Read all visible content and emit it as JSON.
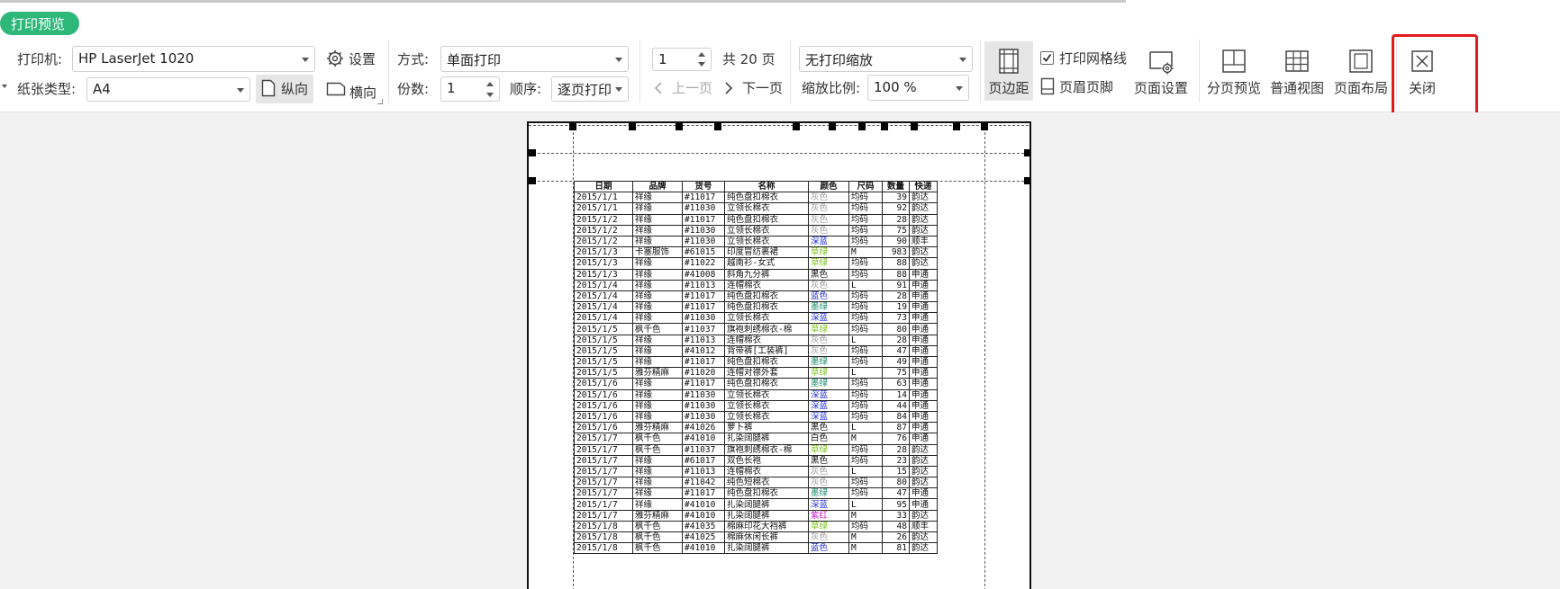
{
  "window": {
    "tab_label": "打印预览"
  },
  "printer": {
    "label": "打印机:",
    "value": "HP LaserJet 1020",
    "settings_label": "设置"
  },
  "paper": {
    "label": "纸张类型:",
    "value": "A4",
    "portrait_label": "纵向",
    "landscape_label": "横向"
  },
  "mode": {
    "label": "方式:",
    "value": "单面打印"
  },
  "copies": {
    "label": "份数:",
    "value": "1"
  },
  "order": {
    "label": "顺序:",
    "value": "逐页打印"
  },
  "pager": {
    "page_value": "1",
    "total_label": "共 20 页",
    "prev_label": "上一页",
    "next_label": "下一页"
  },
  "scale": {
    "mode_value": "无打印缩放",
    "ratio_label": "缩放比例:",
    "ratio_value": "100 %"
  },
  "toolbar": {
    "margins_label": "页边距",
    "gridlines_label": "打印网格线",
    "gridlines_checked": true,
    "header_footer_label": "页眉页脚",
    "page_setup_label": "页面设置",
    "page_break_label": "分页预览",
    "normal_view_label": "普通视图",
    "page_layout_label": "页面布局",
    "close_label": "关闭"
  },
  "colors": {
    "accent_green": "#2db87a",
    "highlight_red": "#e0191e",
    "active_bg": "#e6e6e6"
  },
  "sheet": {
    "headers": [
      "日期",
      "品牌",
      "货号",
      "名称",
      "颜色",
      "尺码",
      "数量",
      "快递"
    ],
    "rows": [
      [
        "2015/1/1",
        "祥缘",
        "#11017",
        "纯色盘扣棉衣",
        "灰色",
        "均码",
        "39",
        "韵达"
      ],
      [
        "2015/1/1",
        "祥缘",
        "#11030",
        "立领长棉衣",
        "灰色",
        "均码",
        "92",
        "韵达"
      ],
      [
        "2015/1/2",
        "祥缘",
        "#11017",
        "纯色盘扣棉衣",
        "灰色",
        "均码",
        "28",
        "韵达"
      ],
      [
        "2015/1/2",
        "祥缘",
        "#11030",
        "立领长棉衣",
        "灰色",
        "均码",
        "75",
        "韵达"
      ],
      [
        "2015/1/2",
        "祥缘",
        "#11030",
        "立领长棉衣",
        "深蓝",
        "均码",
        "90",
        "顺丰"
      ],
      [
        "2015/1/3",
        "卡塞服饰",
        "#61015",
        "印度冒纺裹裙",
        "草绿",
        "M",
        "983",
        "韵达"
      ],
      [
        "2015/1/3",
        "祥缘",
        "#11022",
        "越南衫-女式",
        "草绿",
        "均码",
        "88",
        "韵达"
      ],
      [
        "2015/1/3",
        "祥缘",
        "#41008",
        "斜角九分裤",
        "黑色",
        "均码",
        "88",
        "申通"
      ],
      [
        "2015/1/4",
        "祥缘",
        "#11013",
        "连帽棉衣",
        "灰色",
        "L",
        "91",
        "申通"
      ],
      [
        "2015/1/4",
        "祥缘",
        "#11017",
        "纯色盘扣棉衣",
        "蓝色",
        "均码",
        "28",
        "申通"
      ],
      [
        "2015/1/4",
        "祥缘",
        "#11017",
        "纯色盘扣棉衣",
        "墨绿",
        "均码",
        "19",
        "申通"
      ],
      [
        "2015/1/4",
        "祥缘",
        "#11030",
        "立领长棉衣",
        "深蓝",
        "均码",
        "73",
        "申通"
      ],
      [
        "2015/1/5",
        "枫千色",
        "#11037",
        "旗袍刺绣棉衣-棉",
        "草绿",
        "均码",
        "80",
        "申通"
      ],
      [
        "2015/1/5",
        "祥缘",
        "#11013",
        "连帽棉衣",
        "灰色",
        "L",
        "28",
        "申通"
      ],
      [
        "2015/1/5",
        "祥缘",
        "#41012",
        "背带裤[工装裤]",
        "灰色",
        "均码",
        "47",
        "申通"
      ],
      [
        "2015/1/5",
        "祥缘",
        "#11017",
        "纯色盘扣棉衣",
        "墨绿",
        "均码",
        "49",
        "申通"
      ],
      [
        "2015/1/5",
        "雅芬精麻",
        "#11020",
        "连帽对襟外套",
        "草绿",
        "L",
        "75",
        "申通"
      ],
      [
        "2015/1/6",
        "祥缘",
        "#11017",
        "纯色盘扣棉衣",
        "墨绿",
        "均码",
        "63",
        "申通"
      ],
      [
        "2015/1/6",
        "祥缘",
        "#11030",
        "立领长棉衣",
        "深蓝",
        "均码",
        "14",
        "申通"
      ],
      [
        "2015/1/6",
        "祥缘",
        "#11030",
        "立领长棉衣",
        "深蓝",
        "均码",
        "44",
        "申通"
      ],
      [
        "2015/1/6",
        "祥缘",
        "#11030",
        "立领长棉衣",
        "深蓝",
        "均码",
        "84",
        "申通"
      ],
      [
        "2015/1/6",
        "雅芬精麻",
        "#41026",
        "萝卜裤",
        "黑色",
        "L",
        "87",
        "申通"
      ],
      [
        "2015/1/7",
        "枫千色",
        "#41010",
        "扎染阔腿裤",
        "白色",
        "M",
        "76",
        "申通"
      ],
      [
        "2015/1/7",
        "枫千色",
        "#11037",
        "旗袍刺绣棉衣-棉",
        "草绿",
        "均码",
        "28",
        "韵达"
      ],
      [
        "2015/1/7",
        "祥缘",
        "#61017",
        "双色长袍",
        "黑色",
        "均码",
        "23",
        "韵达"
      ],
      [
        "2015/1/7",
        "祥缘",
        "#11013",
        "连帽棉衣",
        "灰色",
        "L",
        "15",
        "韵达"
      ],
      [
        "2015/1/7",
        "祥缘",
        "#11042",
        "纯色短棉衣",
        "灰色",
        "均码",
        "80",
        "韵达"
      ],
      [
        "2015/1/7",
        "祥缘",
        "#11017",
        "纯色盘扣棉衣",
        "墨绿",
        "均码",
        "47",
        "申通"
      ],
      [
        "2015/1/7",
        "祥缘",
        "#41010",
        "扎染阔腿裤",
        "深蓝",
        "L",
        "95",
        "申通"
      ],
      [
        "2015/1/7",
        "雅芬精麻",
        "#41010",
        "扎染阔腿裤",
        "紫红",
        "M",
        "33",
        "韵达"
      ],
      [
        "2015/1/8",
        "枫千色",
        "#41035",
        "棉麻印花大裆裤",
        "草绿",
        "均码",
        "48",
        "顺丰"
      ],
      [
        "2015/1/8",
        "枫千色",
        "#41025",
        "棉麻休闲长裤",
        "灰色",
        "M",
        "26",
        "韵达"
      ],
      [
        "2015/1/8",
        "枫千色",
        "#41010",
        "扎染阔腿裤",
        "蓝色",
        "M",
        "81",
        "韵达"
      ]
    ]
  }
}
